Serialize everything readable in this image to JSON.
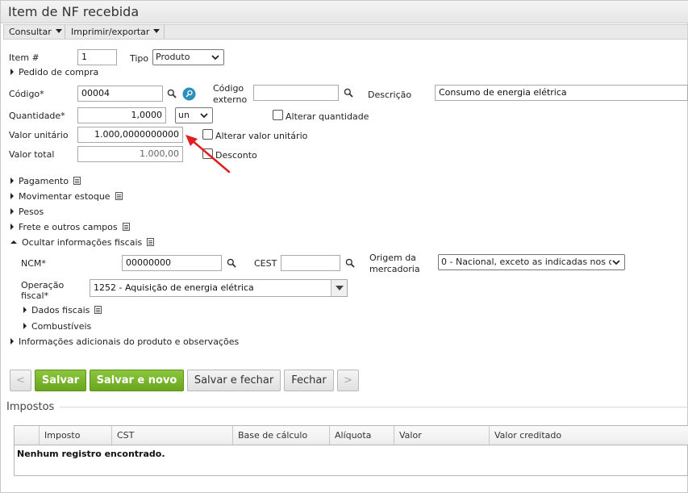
{
  "window": {
    "title": "Item de NF recebida"
  },
  "toolbar": {
    "consultar": "Consultar",
    "imprimir": "Imprimir/exportar"
  },
  "form": {
    "item_label": "Item #",
    "item_value": "1",
    "tipo_label": "Tipo",
    "tipo_value": "Produto",
    "pedido_label": "Pedido de compra",
    "codigo_label": "Código*",
    "codigo_value": "00004",
    "codigo_externo_label_1": "Código",
    "codigo_externo_label_2": "externo",
    "codigo_externo_value": "",
    "descricao_label": "Descrição",
    "descricao_value": "Consumo de energia elétrica",
    "quantidade_label": "Quantidade*",
    "quantidade_value": "1,0000",
    "unidade_value": "un",
    "alterar_quantidade_label": "Alterar quantidade",
    "valor_unitario_label": "Valor unitário",
    "valor_unitario_value": "1.000,0000000000",
    "alterar_valor_label": "Alterar valor unitário",
    "valor_total_label": "Valor total",
    "valor_total_value": "1.000,00",
    "desconto_label": "Desconto"
  },
  "sections": {
    "pagamento": "Pagamento",
    "movimentar": "Movimentar estoque",
    "pesos": "Pesos",
    "frete": "Frete e outros campos",
    "ocultar_fiscais": "Ocultar informações fiscais",
    "dados_fiscais": "Dados fiscais",
    "combustiveis": "Combustíveis",
    "info_adicionais": "Informações adicionais do produto e observações"
  },
  "fiscal": {
    "ncm_label": "NCM*",
    "ncm_value": "00000000",
    "cest_label": "CEST",
    "cest_value": "",
    "origem_label_1": "Origem da",
    "origem_label_2": "mercadoria",
    "origem_value": "0 - Nacional, exceto as indicadas nos c",
    "operacao_label_1": "Operação",
    "operacao_label_2": "fiscal*",
    "operacao_value": "1252 - Aquisição de energia elétrica"
  },
  "buttons": {
    "prev": "<",
    "salvar": "Salvar",
    "salvar_novo": "Salvar e novo",
    "salvar_fechar": "Salvar e fechar",
    "fechar": "Fechar",
    "next": ">"
  },
  "impostos": {
    "title": "Impostos",
    "columns": [
      "Imposto",
      "CST",
      "Base de cálculo",
      "Alíquota",
      "Valor",
      "Valor creditado"
    ],
    "empty_message": "Nenhum registro encontrado."
  },
  "colors": {
    "accent_green": "#7ab829",
    "annotation_arrow": "#e02020",
    "info_icon": "#2a8fbf"
  }
}
